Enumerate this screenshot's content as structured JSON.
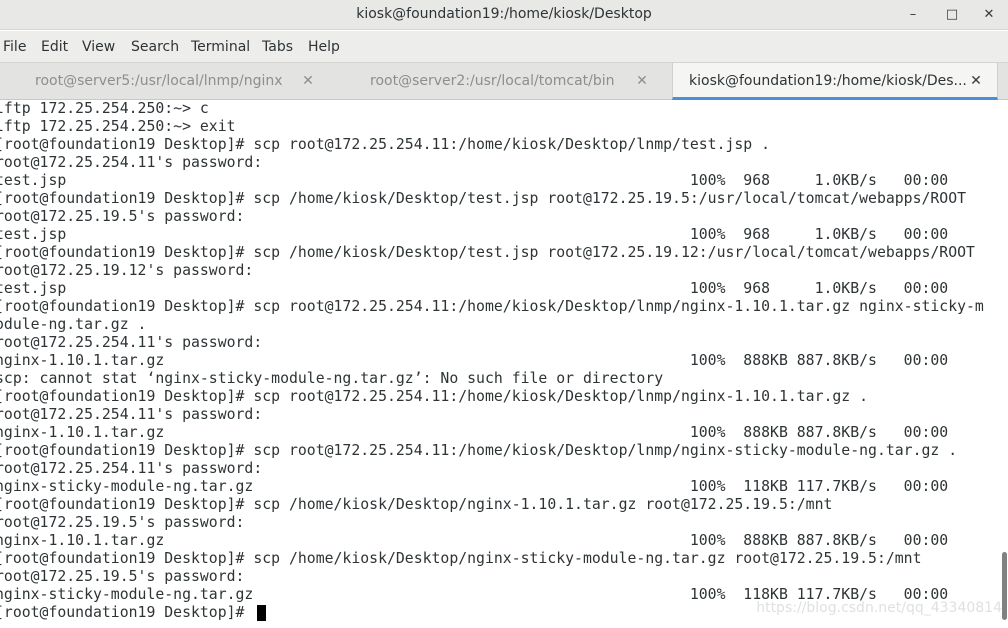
{
  "window": {
    "title": "kiosk@foundation19:/home/kiosk/Desktop",
    "minimize_glyph": "–",
    "maximize_glyph": "□",
    "close_glyph": "✕"
  },
  "menubar": {
    "items": [
      {
        "label": "File"
      },
      {
        "label": "Edit"
      },
      {
        "label": "View"
      },
      {
        "label": "Search"
      },
      {
        "label": "Terminal"
      },
      {
        "label": "Tabs"
      },
      {
        "label": "Help"
      }
    ]
  },
  "tabs": [
    {
      "label": "root@server5:/usr/local/lnmp/nginx",
      "active": false,
      "close_glyph": "✕"
    },
    {
      "label": "root@server2:/usr/local/tomcat/bin",
      "active": false,
      "close_glyph": "✕"
    },
    {
      "label": "kiosk@foundation19:/home/kiosk/Des...",
      "active": true,
      "close_glyph": "✕"
    }
  ],
  "terminal": {
    "lines": [
      "lftp 172.25.254.250:~> c",
      "lftp 172.25.254.250:~> exit",
      "[root@foundation19 Desktop]# scp root@172.25.254.11:/home/kiosk/Desktop/lnmp/test.jsp .",
      "root@172.25.254.11's password: ",
      "test.jsp                                                                      100%  968     1.0KB/s   00:00    ",
      "[root@foundation19 Desktop]# scp /home/kiosk/Desktop/test.jsp root@172.25.19.5:/usr/local/tomcat/webapps/ROOT",
      "root@172.25.19.5's password: ",
      "test.jsp                                                                      100%  968     1.0KB/s   00:00    ",
      "[root@foundation19 Desktop]# scp /home/kiosk/Desktop/test.jsp root@172.25.19.12:/usr/local/tomcat/webapps/ROOT",
      "root@172.25.19.12's password: ",
      "test.jsp                                                                      100%  968     1.0KB/s   00:00    ",
      "[root@foundation19 Desktop]# scp root@172.25.254.11:/home/kiosk/Desktop/lnmp/nginx-1.10.1.tar.gz nginx-sticky-m",
      "odule-ng.tar.gz .",
      "root@172.25.254.11's password: ",
      "nginx-1.10.1.tar.gz                                                           100%  888KB 887.8KB/s   00:00    ",
      "scp: cannot stat ‘nginx-sticky-module-ng.tar.gz’: No such file or directory",
      "[root@foundation19 Desktop]# scp root@172.25.254.11:/home/kiosk/Desktop/lnmp/nginx-1.10.1.tar.gz .",
      "root@172.25.254.11's password: ",
      "nginx-1.10.1.tar.gz                                                           100%  888KB 887.8KB/s   00:00    ",
      "[root@foundation19 Desktop]# scp root@172.25.254.11:/home/kiosk/Desktop/lnmp/nginx-sticky-module-ng.tar.gz .",
      "root@172.25.254.11's password: ",
      "nginx-sticky-module-ng.tar.gz                                                 100%  118KB 117.7KB/s   00:00    ",
      "[root@foundation19 Desktop]# scp /home/kiosk/Desktop/nginx-1.10.1.tar.gz root@172.25.19.5:/mnt",
      "root@172.25.19.5's password: ",
      "nginx-1.10.1.tar.gz                                                           100%  888KB 887.8KB/s   00:00    ",
      "[root@foundation19 Desktop]# scp /home/kiosk/Desktop/nginx-sticky-module-ng.tar.gz root@172.25.19.5:/mnt",
      "root@172.25.19.5's password: ",
      "nginx-sticky-module-ng.tar.gz                                                 100%  118KB 117.7KB/s   00:00    ",
      "[root@foundation19 Desktop]# "
    ]
  },
  "watermark": "https://blog.csdn.net/qq_43340814",
  "colors": {
    "accent": "#4a90d9",
    "terminal_bg": "#ffffff",
    "terminal_fg": "#2e3436"
  }
}
